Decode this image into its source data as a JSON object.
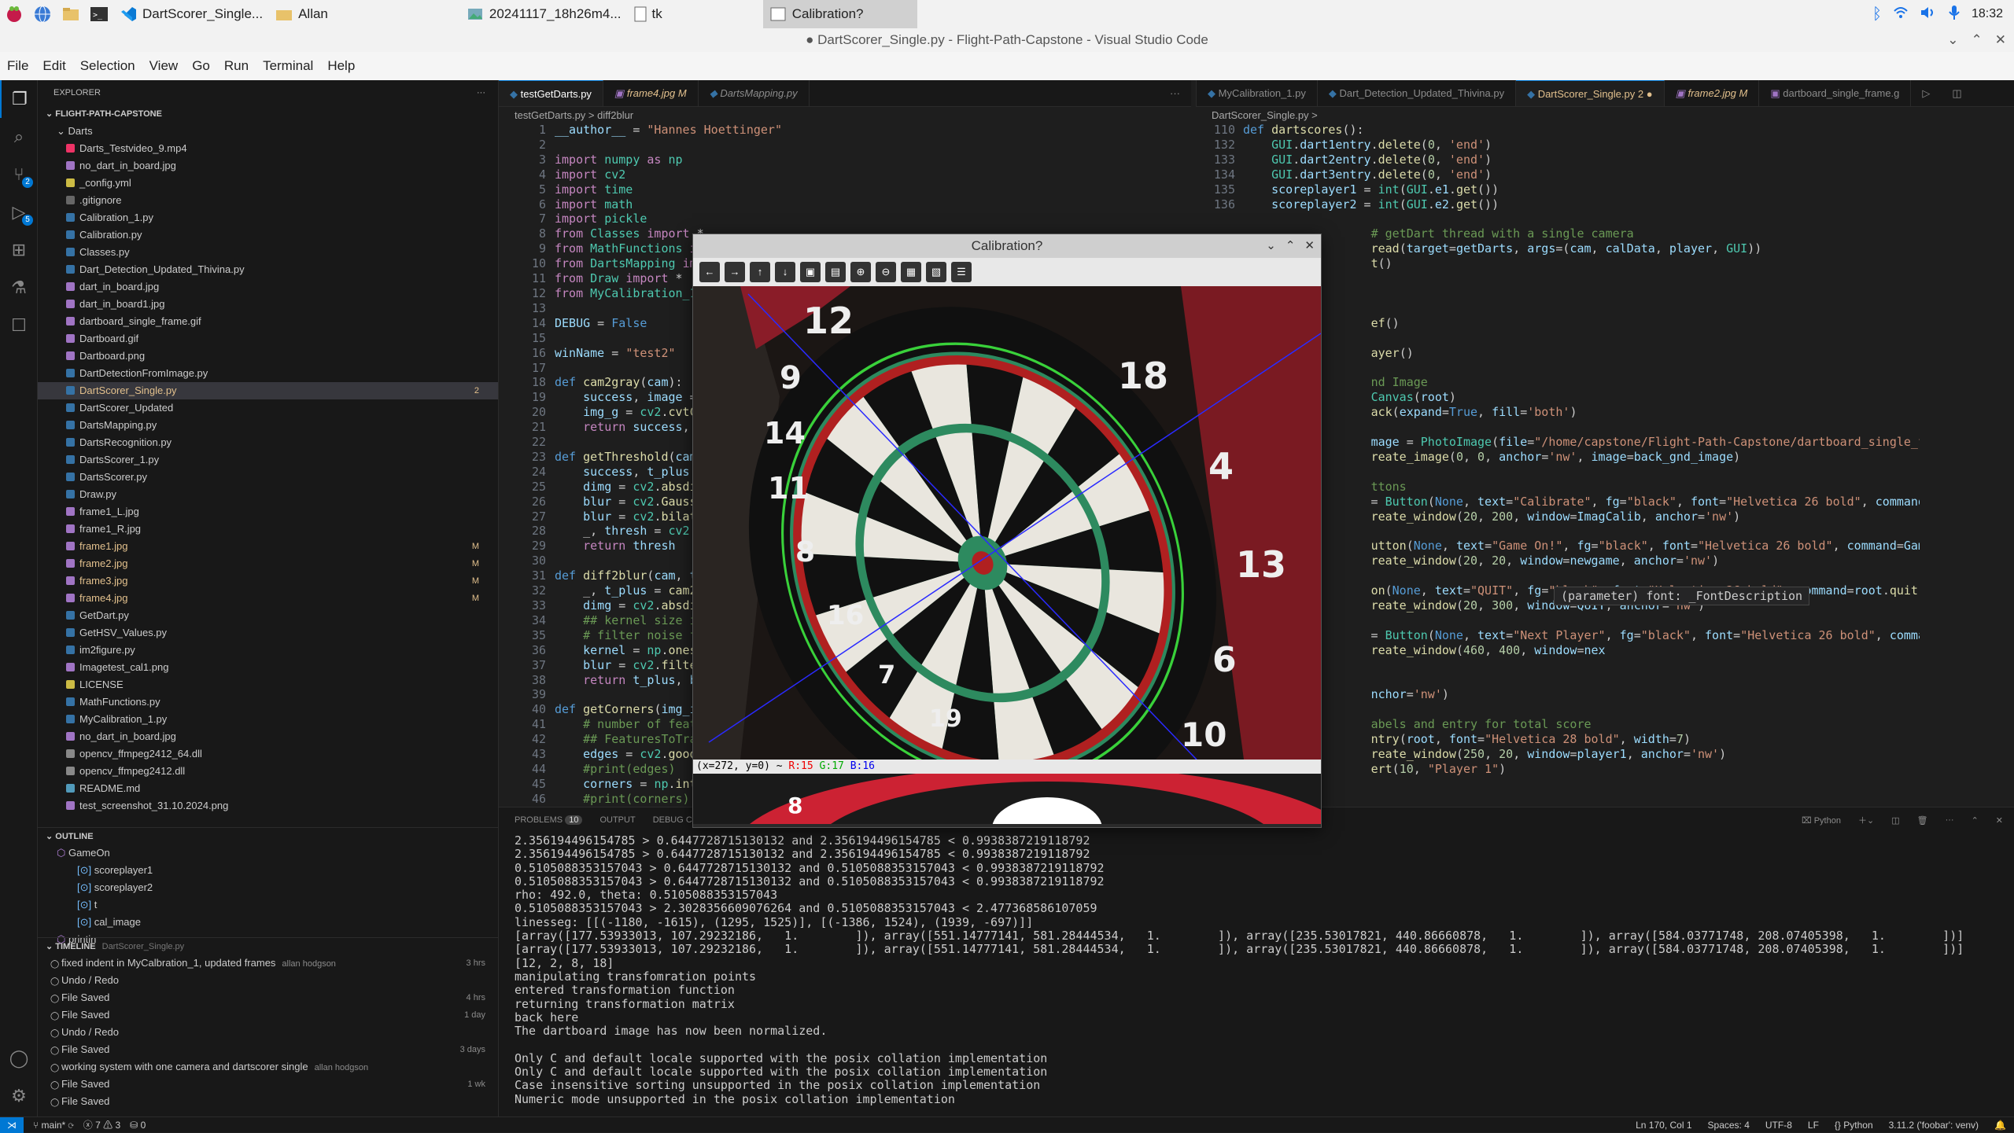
{
  "taskbar": {
    "tasks": [
      {
        "label": "DartScorer_Single...",
        "icon": "vscode-icon"
      },
      {
        "label": "Allan",
        "icon": "folder-icon"
      },
      {
        "label": "20241117_18h26m4...",
        "icon": "image-viewer-icon"
      },
      {
        "label": "tk",
        "icon": "tk-window-icon"
      },
      {
        "label": "Calibration?",
        "icon": "calibration-window-icon",
        "active": true
      }
    ],
    "clock": "18:32"
  },
  "window": {
    "title": "● DartScorer_Single.py - Flight-Path-Capstone - Visual Studio Code"
  },
  "menu": [
    "File",
    "Edit",
    "Selection",
    "View",
    "Go",
    "Run",
    "Terminal",
    "Help"
  ],
  "activity_badges": {
    "scm": "2",
    "run": "5"
  },
  "explorer": {
    "header": "EXPLORER",
    "root": "FLIGHT-PATH-CAPSTONE",
    "items": [
      {
        "name": "Darts",
        "folder": true,
        "color": "#dcb67a"
      },
      {
        "name": "Darts_Testvideo_9.mp4",
        "color": "#e36"
      },
      {
        "name": "no_dart_in_board.jpg",
        "color": "#a074c4"
      },
      {
        "name": "_config.yml",
        "color": "#cb4"
      },
      {
        "name": ".gitignore",
        "color": "#666"
      },
      {
        "name": "Calibration_1.py",
        "color": "#3572a5"
      },
      {
        "name": "Calibration.py",
        "color": "#3572a5"
      },
      {
        "name": "Classes.py",
        "color": "#3572a5"
      },
      {
        "name": "Dart_Detection_Updated_Thivina.py",
        "color": "#3572a5"
      },
      {
        "name": "dart_in_board.jpg",
        "color": "#a074c4"
      },
      {
        "name": "dart_in_board1.jpg",
        "color": "#a074c4"
      },
      {
        "name": "dartboard_single_frame.gif",
        "color": "#a074c4"
      },
      {
        "name": "Dartboard.gif",
        "color": "#a074c4"
      },
      {
        "name": "Dartboard.png",
        "color": "#a074c4"
      },
      {
        "name": "DartDetectionFromImage.py",
        "color": "#3572a5"
      },
      {
        "name": "DartScorer_Single.py",
        "color": "#3572a5",
        "selected": true,
        "badge": "2"
      },
      {
        "name": "DartScorer_Updated",
        "color": "#3572a5"
      },
      {
        "name": "DartsMapping.py",
        "color": "#3572a5"
      },
      {
        "name": "DartsRecognition.py",
        "color": "#3572a5"
      },
      {
        "name": "DartsScorer_1.py",
        "color": "#3572a5"
      },
      {
        "name": "DartsScorer.py",
        "color": "#3572a5"
      },
      {
        "name": "Draw.py",
        "color": "#3572a5"
      },
      {
        "name": "frame1_L.jpg",
        "color": "#a074c4"
      },
      {
        "name": "frame1_R.jpg",
        "color": "#a074c4"
      },
      {
        "name": "frame1.jpg",
        "color": "#a074c4",
        "badge": "M"
      },
      {
        "name": "frame2.jpg",
        "color": "#a074c4",
        "badge": "M"
      },
      {
        "name": "frame3.jpg",
        "color": "#a074c4",
        "badge": "M"
      },
      {
        "name": "frame4.jpg",
        "color": "#a074c4",
        "badge": "M"
      },
      {
        "name": "GetDart.py",
        "color": "#3572a5"
      },
      {
        "name": "GetHSV_Values.py",
        "color": "#3572a5"
      },
      {
        "name": "im2figure.py",
        "color": "#3572a5"
      },
      {
        "name": "Imagetest_cal1.png",
        "color": "#a074c4"
      },
      {
        "name": "LICENSE",
        "color": "#cb4"
      },
      {
        "name": "MathFunctions.py",
        "color": "#3572a5"
      },
      {
        "name": "MyCalibration_1.py",
        "color": "#3572a5"
      },
      {
        "name": "no_dart_in_board.jpg",
        "color": "#a074c4"
      },
      {
        "name": "opencv_ffmpeg2412_64.dll",
        "color": "#888"
      },
      {
        "name": "opencv_ffmpeg2412.dll",
        "color": "#888"
      },
      {
        "name": "README.md",
        "color": "#519aba"
      },
      {
        "name": "test_screenshot_31.10.2024.png",
        "color": "#a074c4"
      }
    ]
  },
  "outline": {
    "header": "OUTLINE",
    "items": [
      "GameOn",
      "scoreplayer1",
      "scoreplayer2",
      "t",
      "cal_image",
      "printin"
    ]
  },
  "timeline": {
    "header": "TIMELINE",
    "file": "DartScorer_Single.py",
    "items": [
      {
        "label": "fixed indent in MyCalbration_1, updated frames",
        "author": "allan hodgson",
        "time": "3 hrs"
      },
      {
        "label": "Undo / Redo",
        "author": "",
        "time": ""
      },
      {
        "label": "File Saved",
        "author": "",
        "time": "4 hrs"
      },
      {
        "label": "File Saved",
        "author": "",
        "time": "1 day"
      },
      {
        "label": "Undo / Redo",
        "author": "",
        "time": ""
      },
      {
        "label": "File Saved",
        "author": "",
        "time": "3 days"
      },
      {
        "label": "working system with one camera and dartscorer single",
        "author": "allan hodgson",
        "time": ""
      },
      {
        "label": "File Saved",
        "author": "",
        "time": "1 wk"
      },
      {
        "label": "File Saved",
        "author": "",
        "time": ""
      }
    ]
  },
  "left_editor": {
    "tabs": [
      {
        "label": "testGetDarts.py",
        "active": true
      },
      {
        "label": "frame4.jpg  M",
        "active": false
      },
      {
        "label": "DartsMapping.py",
        "active": false
      }
    ],
    "breadcrumb": "testGetDarts.py  >  diff2blur"
  },
  "right_editor": {
    "tabs": [
      {
        "label": "MyCalibration_1.py",
        "active": false
      },
      {
        "label": "Dart_Detection_Updated_Thivina.py",
        "active": false
      },
      {
        "label": "DartScorer_Single.py  2  ●",
        "active": true
      },
      {
        "label": "frame2.jpg  M",
        "active": false
      },
      {
        "label": "dartboard_single_frame.g",
        "active": false
      }
    ],
    "breadcrumb": "DartScorer_Single.py  >"
  },
  "panel": {
    "tabs": [
      "PROBLEMS",
      "OUTPUT",
      "DEBUG CONSOLE"
    ],
    "problems_count": "10",
    "terminal_name": "Python"
  },
  "calibration": {
    "title": "Calibration?",
    "status_prefix": "(x=272, y=0) ~ ",
    "r": "R:15",
    "g": "G:17",
    "b": "B:16"
  },
  "tooltip": "(parameter) font: _FontDescription",
  "status": {
    "branch": "main*",
    "errors": "7",
    "warnings": "3",
    "ports": "0",
    "position": "Ln 170, Col 1",
    "spaces": "Spaces: 4",
    "encoding": "UTF-8",
    "eol": "LF",
    "language": "Python",
    "interpreter": "3.11.2 ('foobar': venv)"
  },
  "colors": {
    "accent": "#0078d4",
    "modified": "#e2c08d"
  }
}
